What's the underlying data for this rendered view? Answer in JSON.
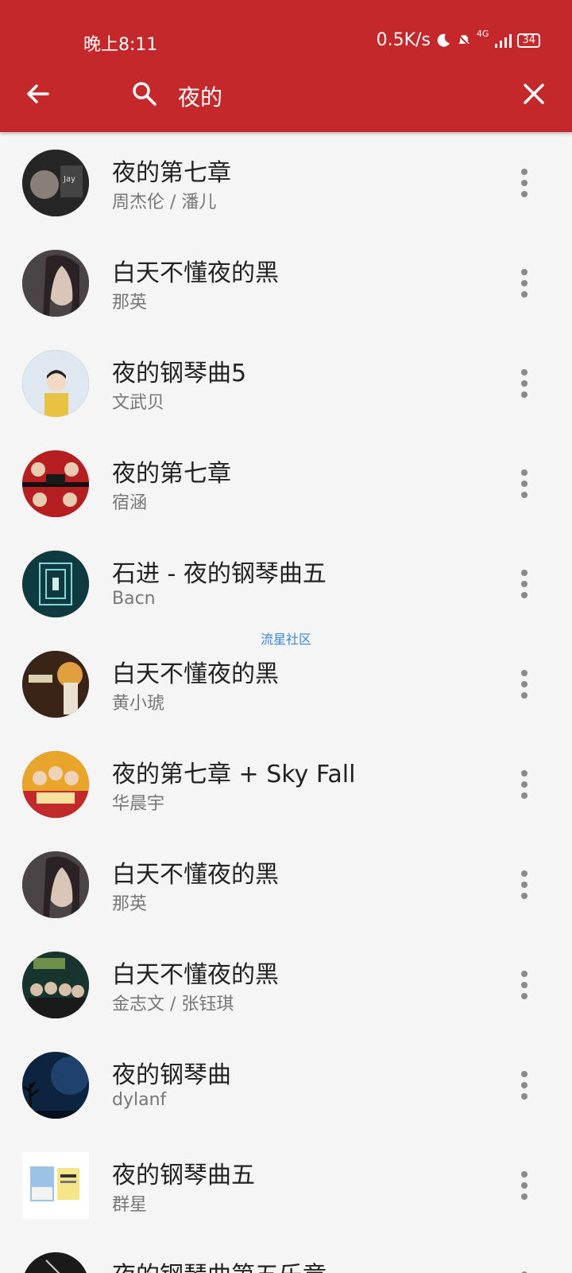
{
  "status_bar": {
    "time": "晚上8:11",
    "speed": "0.5K/s",
    "network": "4G",
    "battery": "34"
  },
  "search": {
    "query": "夜的"
  },
  "results": [
    {
      "title": "夜的第七章",
      "artist": "周杰伦 / 潘儿"
    },
    {
      "title": "白天不懂夜的黑",
      "artist": "那英"
    },
    {
      "title": "夜的钢琴曲5",
      "artist": "文武贝"
    },
    {
      "title": "夜的第七章",
      "artist": "宿涵"
    },
    {
      "title": "石进 - 夜的钢琴曲五",
      "artist": "Bacn"
    },
    {
      "title": "白天不懂夜的黑",
      "artist": "黄小琥"
    },
    {
      "title": "夜的第七章 + Sky Fall",
      "artist": "华晨宇"
    },
    {
      "title": "白天不懂夜的黑",
      "artist": "那英"
    },
    {
      "title": "白天不懂夜的黑",
      "artist": "金志文 / 张钰琪"
    },
    {
      "title": "夜的钢琴曲",
      "artist": "dylanf"
    },
    {
      "title": "夜的钢琴曲五",
      "artist": "群星"
    },
    {
      "title": "夜的钢琴曲第五乐章",
      "artist": ""
    }
  ],
  "watermark": "流星社区",
  "colors": {
    "appbar": "#c5282b",
    "background": "#f5f5f5"
  }
}
